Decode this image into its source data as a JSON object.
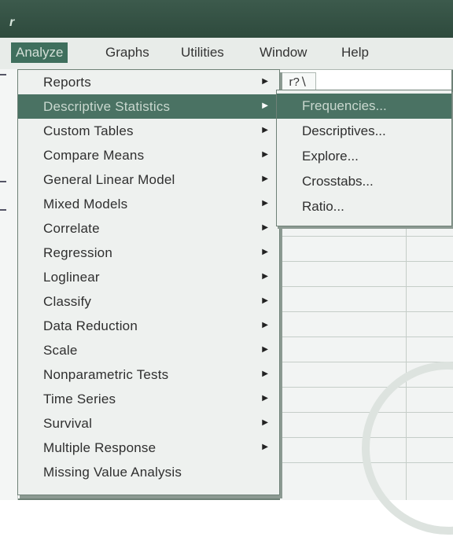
{
  "window": {
    "title_glyph": "r"
  },
  "menubar": {
    "items": [
      {
        "label": "Analyze",
        "active": true
      },
      {
        "label": "Graphs"
      },
      {
        "label": "Utilities"
      },
      {
        "label": "Window"
      },
      {
        "label": "Help"
      }
    ]
  },
  "toolbar": {
    "icon_text": "r?∖"
  },
  "analyze_menu": {
    "items": [
      {
        "label": "Reports",
        "submenu": true
      },
      {
        "label": "Descriptive Statistics",
        "submenu": true,
        "selected": true
      },
      {
        "label": "Custom Tables",
        "submenu": true
      },
      {
        "label": "Compare Means",
        "submenu": true
      },
      {
        "label": "General Linear Model",
        "submenu": true
      },
      {
        "label": "Mixed Models",
        "submenu": true
      },
      {
        "label": "Correlate",
        "submenu": true
      },
      {
        "label": "Regression",
        "submenu": true
      },
      {
        "label": "Loglinear",
        "submenu": true
      },
      {
        "label": "Classify",
        "submenu": true
      },
      {
        "label": "Data Reduction",
        "submenu": true
      },
      {
        "label": "Scale",
        "submenu": true
      },
      {
        "label": "Nonparametric Tests",
        "submenu": true
      },
      {
        "label": "Time Series",
        "submenu": true
      },
      {
        "label": "Survival",
        "submenu": true
      },
      {
        "label": "Multiple Response",
        "submenu": true
      },
      {
        "label": "Missing Value Analysis",
        "submenu": false
      }
    ]
  },
  "descriptive_submenu": {
    "items": [
      {
        "label": "Frequencies...",
        "selected": true
      },
      {
        "label": "Descriptives..."
      },
      {
        "label": "Explore..."
      },
      {
        "label": "Crosstabs..."
      },
      {
        "label": "Ratio..."
      }
    ]
  },
  "colors": {
    "titlebar": "#2e4a3d",
    "highlight": "#4a7263",
    "menu_bg": "#eef1ef"
  }
}
